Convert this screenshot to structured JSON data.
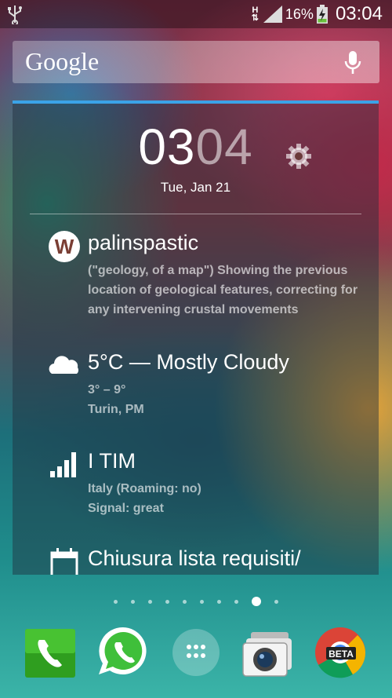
{
  "status_bar": {
    "network_type": "H",
    "battery": "16%",
    "time": "03:04"
  },
  "search": {
    "logo": "Google"
  },
  "widget": {
    "clock": {
      "hours": "03",
      "minutes": "04"
    },
    "date": "Tue, Jan 21",
    "word": {
      "icon_letter": "W",
      "title": "palinspastic",
      "lines": [
        "(\"geology, of a map\") Showing the previous",
        "location of geological features, correcting for",
        "any intervening crustal movements"
      ]
    },
    "weather": {
      "title": "5°C — Mostly Cloudy",
      "range": "3° – 9°",
      "location": "Turin, PM"
    },
    "network": {
      "title": "I TIM",
      "line1": "Italy (Roaming: no)",
      "line2": "Signal: great"
    },
    "calendar": {
      "title": "Chiusura lista requisiti/"
    }
  },
  "dock": {
    "chrome_badge": "BETA"
  }
}
